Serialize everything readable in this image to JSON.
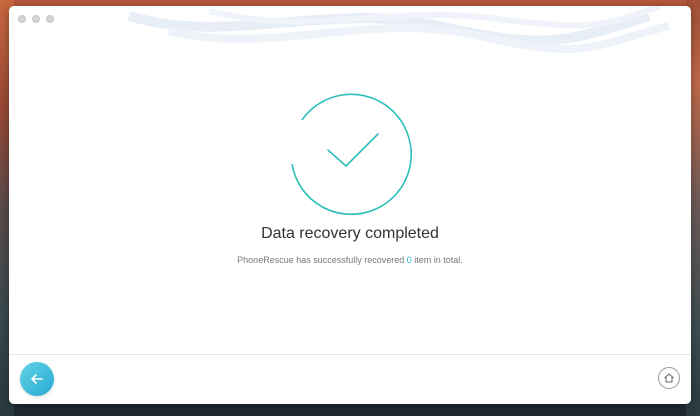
{
  "window": {
    "traffic_lights": [
      "close",
      "minimize",
      "zoom"
    ]
  },
  "result": {
    "title": "Data recovery completed",
    "message_prefix": "PhoneRescue has successfully recovered ",
    "recovered_count": "0",
    "message_suffix": " item in total."
  },
  "footer": {
    "back_icon": "arrow-left-icon",
    "home_icon": "home-icon"
  },
  "colors": {
    "accent": "#22b6c8",
    "check_stroke": "#2ec0b8",
    "back_button_from": "#5fd3e2",
    "back_button_to": "#29a9d6"
  }
}
